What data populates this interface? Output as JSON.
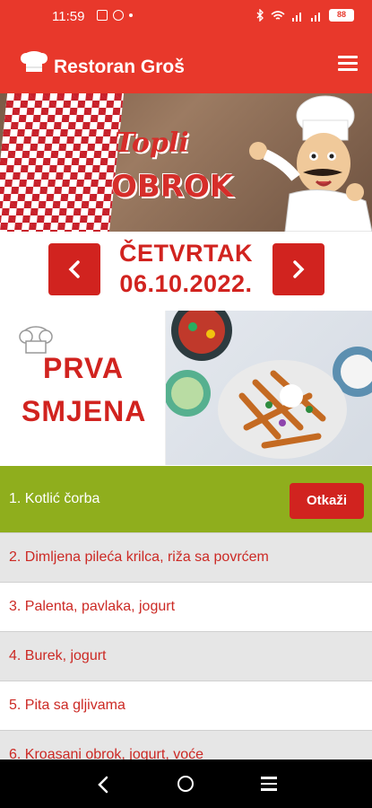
{
  "status_bar": {
    "time": "11:59",
    "battery": "88"
  },
  "app_bar": {
    "title": "Restoran Groš"
  },
  "banner": {
    "title_line1": "Topli",
    "title_line2": "OBROK"
  },
  "date_nav": {
    "day": "ČETVRTAK",
    "date": "06.10.2022."
  },
  "shift": {
    "title_line1": "PRVA",
    "title_line2": "SMJENA"
  },
  "menu": {
    "items": [
      {
        "label": "1. Kotlić čorba"
      },
      {
        "label": "2. Dimljena pileća krilca, riža sa povrćem"
      },
      {
        "label": "3. Palenta, pavlaka, jogurt"
      },
      {
        "label": "4. Burek, jogurt"
      },
      {
        "label": "5. Pita sa gljivama"
      },
      {
        "label": "6. Kroasani obrok, jogurt, voće"
      }
    ],
    "cancel_label": "Otkaži"
  },
  "colors": {
    "brand": "#e8382b",
    "accent": "#d1231f",
    "selected": "#8fae1d"
  }
}
